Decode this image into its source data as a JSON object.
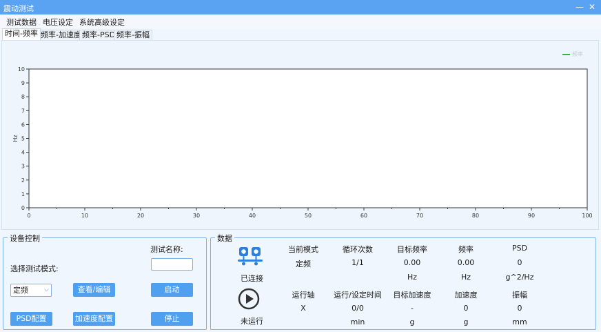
{
  "window": {
    "title": "震动测试",
    "minimize": "—",
    "close": "✕"
  },
  "menu": [
    "测试数据",
    "电压设定",
    "系统高级设定"
  ],
  "tabs": [
    "时间-频率",
    "频率-加速度",
    "频率-PSD",
    "频率-振幅"
  ],
  "active_tab": 0,
  "chart_data": {
    "type": "line",
    "title": "",
    "xlabel": "",
    "ylabel": "Hz",
    "xlim": [
      0,
      100
    ],
    "ylim": [
      0,
      10
    ],
    "x_ticks": [
      0,
      10,
      20,
      30,
      40,
      50,
      60,
      70,
      80,
      90,
      100
    ],
    "y_ticks": [
      0,
      1,
      2,
      3,
      4,
      5,
      6,
      7,
      8,
      9,
      10
    ],
    "series": [
      {
        "name": "频率",
        "color": "#3cb043",
        "x": [],
        "y": []
      }
    ],
    "legend": "top-right",
    "grid": false
  },
  "device_control": {
    "title": "设备控制",
    "test_name_label": "测试名称:",
    "test_name_value": "",
    "mode_label": "选择测试模式:",
    "mode_value": "定频",
    "view_edit_button": "查看/编辑",
    "start_button": "启动",
    "psd_config_button": "PSD配置",
    "accel_config_button": "加速度配置",
    "stop_button": "停止"
  },
  "data_panel": {
    "title": "数据",
    "connection_status": "已连接",
    "run_status": "未运行",
    "row1_headers": [
      "当前模式",
      "循环次数",
      "目标频率",
      "频率",
      "PSD"
    ],
    "row1_values": [
      "定频",
      "1/1",
      "0.00",
      "0.00",
      "0"
    ],
    "row1_units": [
      "",
      "",
      "Hz",
      "Hz",
      "g^2/Hz"
    ],
    "row2_headers": [
      "运行轴",
      "运行/设定时间",
      "目标加速度",
      "加速度",
      "振幅"
    ],
    "row2_values": [
      "X",
      "0/0",
      "-",
      "0",
      "0"
    ],
    "row2_units": [
      "",
      "min",
      "g",
      "g",
      "mm"
    ]
  },
  "colors": {
    "accent": "#4fa0f0",
    "titlebar": "#5aa2f2",
    "border": "#7fb2e8",
    "series": "#3cb043"
  }
}
